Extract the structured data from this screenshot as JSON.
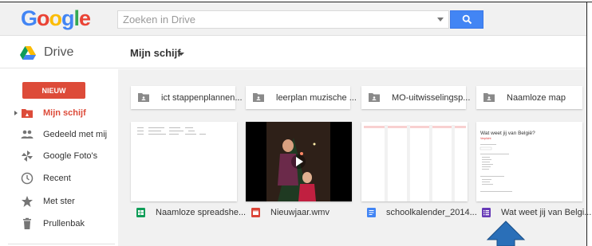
{
  "header": {
    "logo_letters": [
      {
        "char": "G",
        "color": "#4285f4"
      },
      {
        "char": "o",
        "color": "#ea4335"
      },
      {
        "char": "o",
        "color": "#fbbc05"
      },
      {
        "char": "g",
        "color": "#4285f4"
      },
      {
        "char": "l",
        "color": "#34a853"
      },
      {
        "char": "e",
        "color": "#ea4335"
      }
    ],
    "search_placeholder": "Zoeken in Drive",
    "search_button_icon": "search-icon"
  },
  "subheader": {
    "app_name": "Drive",
    "location": "Mijn schijf"
  },
  "sidebar": {
    "new_label": "NIEUW",
    "items": [
      {
        "label": "Mijn schijf",
        "icon": "drive-folder-icon",
        "active": true
      },
      {
        "label": "Gedeeld met mij",
        "icon": "people-icon",
        "active": false
      },
      {
        "label": "Google Foto's",
        "icon": "pinwheel-icon",
        "active": false
      },
      {
        "label": "Recent",
        "icon": "clock-icon",
        "active": false
      },
      {
        "label": "Met ster",
        "icon": "star-icon",
        "active": false
      },
      {
        "label": "Prullenbak",
        "icon": "trash-icon",
        "active": false
      }
    ]
  },
  "folders": [
    {
      "name": "ict stappenplannen..."
    },
    {
      "name": "leerplan muzische ..."
    },
    {
      "name": "MO-uitwisselingsp..."
    },
    {
      "name": "Naamloze map"
    }
  ],
  "files": [
    {
      "name": "Naamloze spreadshe...",
      "type": "spreadsheet",
      "color": "#0f9d58"
    },
    {
      "name": "Nieuwjaar.wmv",
      "type": "video",
      "color": "#db4437"
    },
    {
      "name": "schoolkalender_2014...",
      "type": "document",
      "color": "#4285f4"
    },
    {
      "name": "Wat weet jij van Belgi...",
      "type": "form",
      "color": "#673ab7"
    }
  ],
  "form_preview": {
    "title": "Wat weet jij van België?",
    "subtitle": "Verplicht"
  },
  "colors": {
    "accent_red": "#dd4b39",
    "accent_blue": "#4285f4",
    "cursor_blue": "#2a6fb8"
  }
}
